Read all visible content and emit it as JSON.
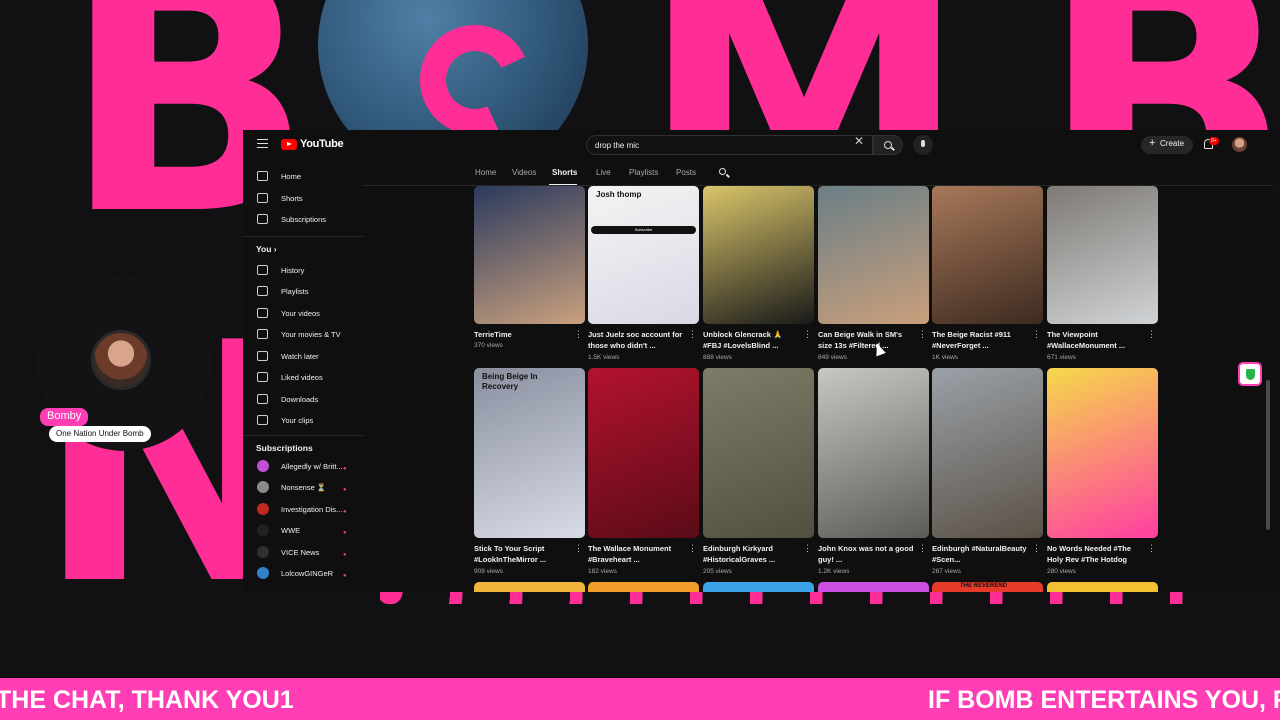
{
  "overlay": {
    "ticker_left": "THE CHAT, THANK YOU1",
    "ticker_right": "IF BOMB ENTERTAINS YOU, F",
    "cam_name": "Bomby",
    "cam_tag": "One Nation Under Bomb",
    "accent_color": "#ff3eb5"
  },
  "youtube": {
    "logo_text": "YouTube",
    "search_value": "drop the mic",
    "create_label": "Create",
    "notification_badge": "9+",
    "sidebar": {
      "main": [
        {
          "label": "Home",
          "icon": "home-icon"
        },
        {
          "label": "Shorts",
          "icon": "shorts-icon"
        },
        {
          "label": "Subscriptions",
          "icon": "subscriptions-icon"
        }
      ],
      "you_heading": "You",
      "you_chevron": "›",
      "you_items": [
        {
          "label": "History",
          "icon": "history-icon"
        },
        {
          "label": "Playlists",
          "icon": "playlists-icon"
        },
        {
          "label": "Your videos",
          "icon": "your-videos-icon"
        },
        {
          "label": "Your movies & TV",
          "icon": "movies-icon"
        },
        {
          "label": "Watch later",
          "icon": "clock-icon"
        },
        {
          "label": "Liked videos",
          "icon": "thumbs-up-icon"
        },
        {
          "label": "Downloads",
          "icon": "download-icon"
        },
        {
          "label": "Your clips",
          "icon": "scissors-icon"
        }
      ],
      "subscriptions_heading": "Subscriptions",
      "subscriptions": [
        {
          "label": "Allegedly w/ Britt...",
          "color": "#c24fd6"
        },
        {
          "label": "Nonsense ⏳",
          "color": "#8a8a8a"
        },
        {
          "label": "Investigation Dis...",
          "color": "#c2281f"
        },
        {
          "label": "WWE",
          "color": "#222222"
        },
        {
          "label": "VICE News",
          "color": "#303030"
        },
        {
          "label": "LolcowGINGeR",
          "color": "#2f82c7"
        }
      ]
    },
    "tabs": [
      "Home",
      "Videos",
      "Shorts",
      "Live",
      "Playlists",
      "Posts"
    ],
    "active_tab": "Shorts",
    "shorts": [
      {
        "title": "TerrieTime",
        "views": "370 views",
        "colors": [
          "#2b3a5e",
          "#c9a07e"
        ]
      },
      {
        "title": "Just Juelz soc account for those who didn't ...",
        "views": "1.5K views",
        "colors": [
          "#f4f4f4",
          "#d9d9e6"
        ],
        "thumb_text": "Josh thomp",
        "thumb_button": "Subscribe"
      },
      {
        "title": "Unblock Glencrack 🙏 #FBJ #LovelsBlind ...",
        "views": "888 views",
        "colors": [
          "#d9c56a",
          "#1a1a1a"
        ]
      },
      {
        "title": "Can Beige Walk in SM's size 13s #Filtered ...",
        "views": "849 views",
        "colors": [
          "#6b7f86",
          "#c99f7c"
        ]
      },
      {
        "title": "The Beige Racist #911 #NeverForget ...",
        "views": "1K views",
        "colors": [
          "#a7785a",
          "#3d2a20"
        ]
      },
      {
        "title": "The Viewpoint #WallaceMonument ...",
        "views": "671 views",
        "colors": [
          "#7e7a74",
          "#d0d3d6"
        ]
      },
      {
        "title": "Stick To Your Script #LookInTheMirror ...",
        "views": "908 views",
        "colors": [
          "#8a8fa0",
          "#d8dce6"
        ],
        "thumb_text": "Being Beige In Recovery"
      },
      {
        "title": "The Wallace Monument #Braveheart ...",
        "views": "182 views",
        "colors": [
          "#b3132e",
          "#5b0b17"
        ]
      },
      {
        "title": "Edinburgh Kirkyard #HistoricalGraves ...",
        "views": "205 views",
        "colors": [
          "#7e7b68",
          "#51503f"
        ]
      },
      {
        "title": "John Knox was not a good guy! ...",
        "views": "1.2K views",
        "colors": [
          "#c8c7c2",
          "#5d5b55"
        ]
      },
      {
        "title": "Edinburgh #NaturalBeauty #Scen...",
        "views": "287 views",
        "colors": [
          "#9aa1a8",
          "#5b5146"
        ]
      },
      {
        "title": "No Words Needed #The Holy Rev #The Hotdog",
        "views": "280 views",
        "colors": [
          "#f6d84a",
          "#ff3ea1"
        ]
      }
    ],
    "next_row_colors": [
      "#f0b43a",
      "#f29d2a",
      "#3ba3e8",
      "#c94fe0",
      "#e63a2a",
      "#f2c233"
    ],
    "next_row_text": "THE REVEREND"
  }
}
